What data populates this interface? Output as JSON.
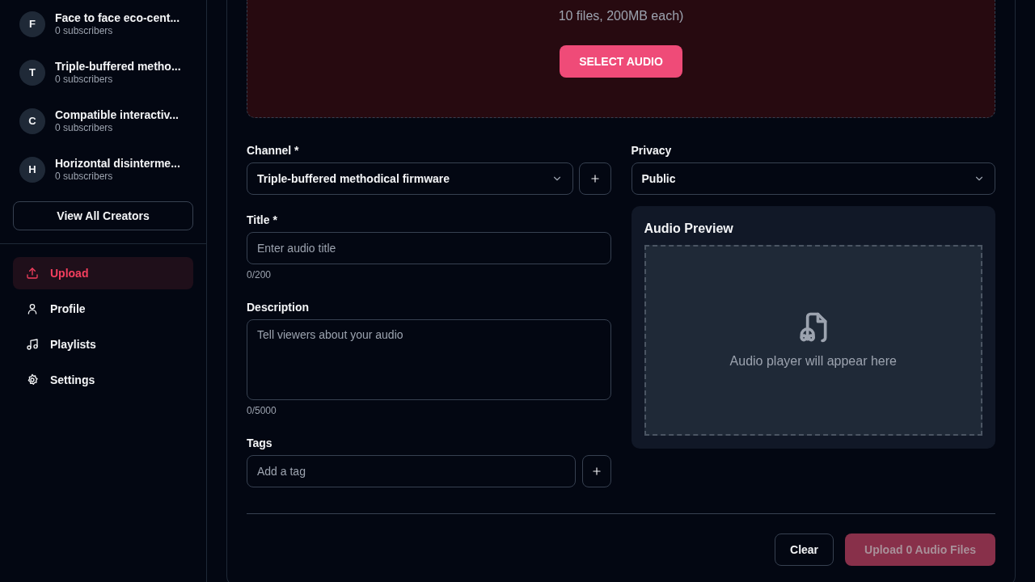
{
  "sidebar": {
    "creators": [
      {
        "initial": "F",
        "name": "Face to face eco-cent...",
        "subscribers": "0 subscribers"
      },
      {
        "initial": "T",
        "name": "Triple-buffered metho...",
        "subscribers": "0 subscribers"
      },
      {
        "initial": "C",
        "name": "Compatible interactiv...",
        "subscribers": "0 subscribers"
      },
      {
        "initial": "H",
        "name": "Horizontal disinterme...",
        "subscribers": "0 subscribers"
      }
    ],
    "view_all_button": "View All Creators",
    "nav": [
      {
        "kind": "upload",
        "label": "Upload",
        "selected": true
      },
      {
        "kind": "profile",
        "label": "Profile",
        "selected": false
      },
      {
        "kind": "playlists",
        "label": "Playlists",
        "selected": false
      },
      {
        "kind": "settings",
        "label": "Settings",
        "selected": false
      }
    ]
  },
  "dropzone": {
    "hint": "10 files, 200MB each)",
    "button": "SELECT AUDIO"
  },
  "form": {
    "channel": {
      "label": "Channel *",
      "value": "Triple-buffered methodical firmware"
    },
    "privacy": {
      "label": "Privacy",
      "value": "Public"
    },
    "title": {
      "label": "Title *",
      "placeholder": "Enter audio title",
      "counter": "0/200"
    },
    "description": {
      "label": "Description",
      "placeholder": "Tell viewers about your audio",
      "counter": "0/5000"
    },
    "tags": {
      "label": "Tags",
      "placeholder": "Add a tag"
    }
  },
  "preview": {
    "title": "Audio Preview",
    "empty_text": "Audio player will appear here"
  },
  "actions": {
    "clear": "Clear",
    "upload": {
      "label": "Upload 0 Audio Files",
      "disabled": true
    }
  }
}
